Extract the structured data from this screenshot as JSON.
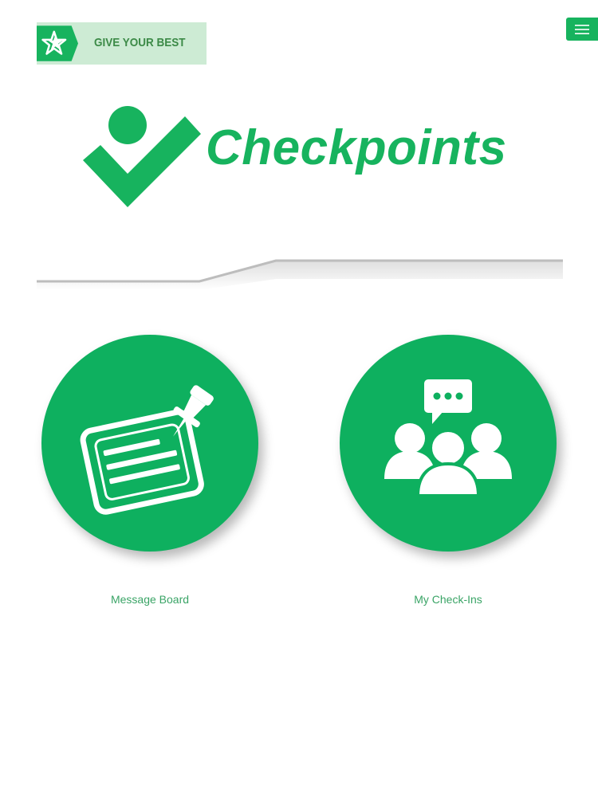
{
  "brand": {
    "tagline": "GIVE YOUR BEST",
    "logo_icon": "star-icon"
  },
  "header": {
    "menu_icon": "hamburger-menu-icon"
  },
  "app": {
    "title": "Checkpoints",
    "logo_icon": "checkmark-person-icon"
  },
  "tiles": [
    {
      "label": "Message Board",
      "icon": "pinned-note-icon"
    },
    {
      "label": "My Check-Ins",
      "icon": "group-chat-icon"
    }
  ],
  "colors": {
    "primary_green": "#17b35e",
    "banner_light_green": "#cdebd4",
    "tagline_green": "#3c8a47",
    "label_green": "#3aa466",
    "background": "#ffffff"
  }
}
